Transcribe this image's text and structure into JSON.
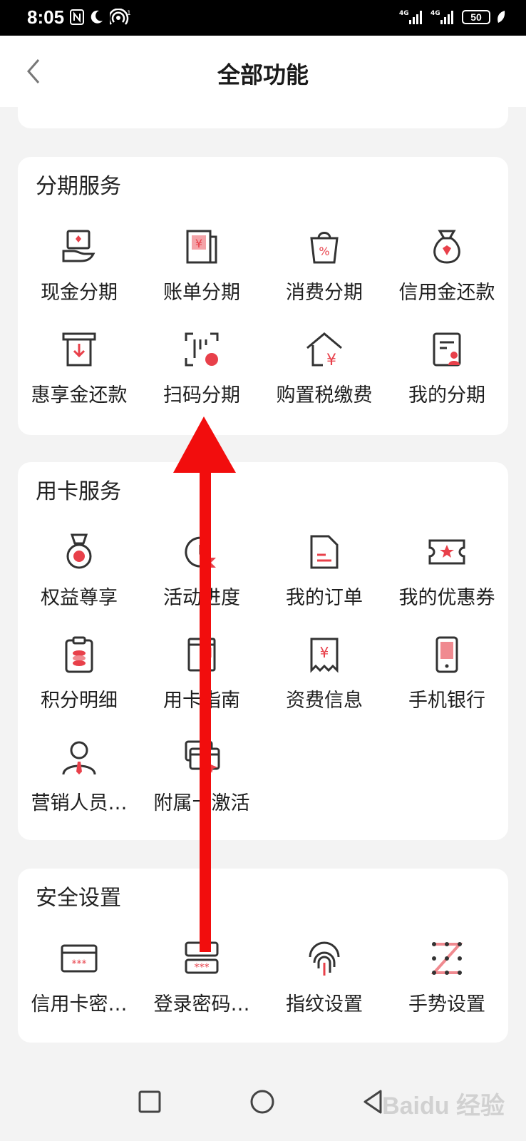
{
  "status": {
    "time": "8:05",
    "battery": "50",
    "signal1": "4G",
    "signal2": "4G"
  },
  "header": {
    "title": "全部功能"
  },
  "sections": [
    {
      "title": "分期服务",
      "items": [
        {
          "label": "现金分期",
          "icon": "cash-installment-icon"
        },
        {
          "label": "账单分期",
          "icon": "bill-installment-icon"
        },
        {
          "label": "消费分期",
          "icon": "shopping-bag-icon"
        },
        {
          "label": "信用金还款",
          "icon": "money-bag-icon"
        },
        {
          "label": "惠享金还款",
          "icon": "download-box-icon"
        },
        {
          "label": "扫码分期",
          "icon": "scan-code-icon"
        },
        {
          "label": "购置税缴费",
          "icon": "house-yen-icon"
        },
        {
          "label": "我的分期",
          "icon": "user-document-icon"
        }
      ]
    },
    {
      "title": "用卡服务",
      "items": [
        {
          "label": "权益尊享",
          "icon": "medal-icon"
        },
        {
          "label": "活动进度",
          "icon": "progress-clock-icon"
        },
        {
          "label": "我的订单",
          "icon": "order-document-icon"
        },
        {
          "label": "我的优惠券",
          "icon": "coupon-icon"
        },
        {
          "label": "积分明细",
          "icon": "points-clipboard-icon"
        },
        {
          "label": "用卡指南",
          "icon": "guide-book-icon"
        },
        {
          "label": "资费信息",
          "icon": "receipt-yen-icon"
        },
        {
          "label": "手机银行",
          "icon": "mobile-phone-icon"
        },
        {
          "label": "营销人员…",
          "icon": "salesperson-icon"
        },
        {
          "label": "附属卡激活",
          "icon": "card-activate-icon"
        }
      ]
    },
    {
      "title": "安全设置",
      "items": [
        {
          "label": "信用卡密…",
          "icon": "card-password-icon"
        },
        {
          "label": "登录密码…",
          "icon": "login-password-icon"
        },
        {
          "label": "指纹设置",
          "icon": "fingerprint-icon"
        },
        {
          "label": "手势设置",
          "icon": "gesture-pattern-icon"
        }
      ]
    }
  ],
  "watermark": "Baidu 经验",
  "colors": {
    "accent": "#e8404a",
    "arrow": "#f20d0d",
    "page_bg": "#f3f3f3"
  }
}
